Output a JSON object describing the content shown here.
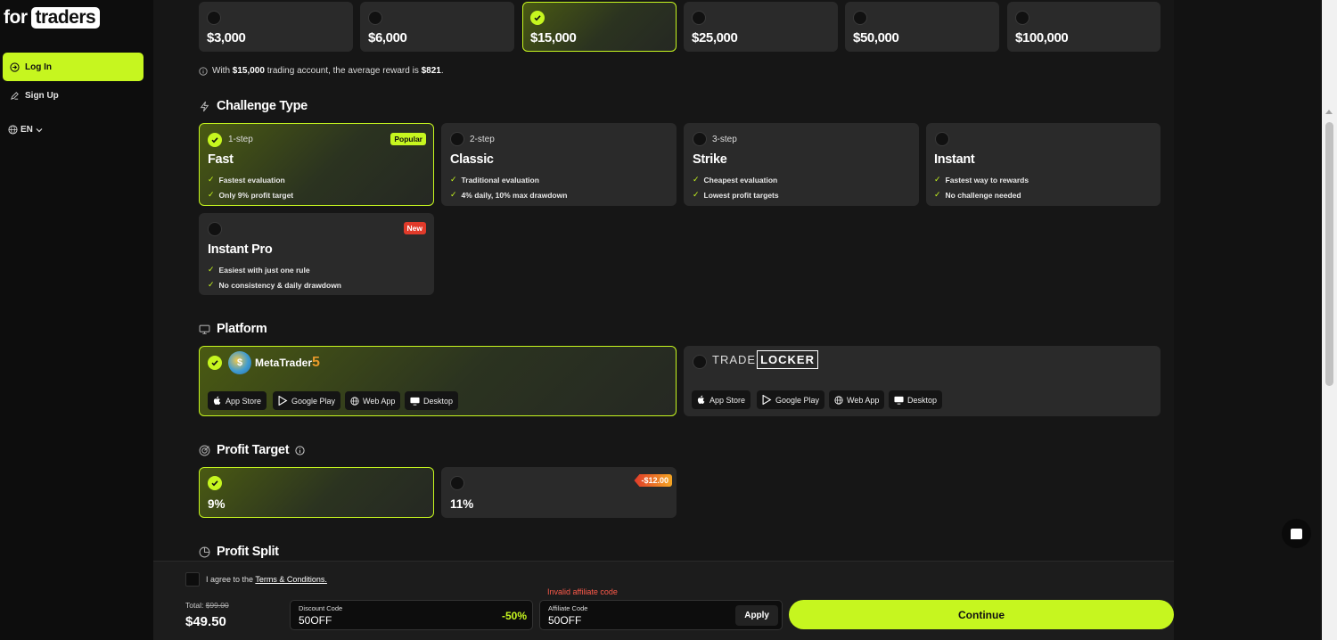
{
  "brand": {
    "for": "for",
    "traders": "traders"
  },
  "nav": {
    "login": "Log In",
    "signup": "Sign Up",
    "lang": "EN"
  },
  "accounts": [
    {
      "label": "$3,000",
      "selected": false
    },
    {
      "label": "$6,000",
      "selected": false
    },
    {
      "label": "$15,000",
      "selected": true
    },
    {
      "label": "$25,000",
      "selected": false
    },
    {
      "label": "$50,000",
      "selected": false
    },
    {
      "label": "$100,000",
      "selected": false
    }
  ],
  "info": {
    "pre": "With",
    "amount": "$15,000",
    "mid": "trading account, the average reward is",
    "reward": "$821",
    "post": "."
  },
  "challenge": {
    "title": "Challenge Type",
    "types": [
      {
        "step": "1-step",
        "name": "Fast",
        "badge": "Popular",
        "f1": "Fastest evaluation",
        "f2": "Only 9% profit target"
      },
      {
        "step": "2-step",
        "name": "Classic",
        "f1": "Traditional evaluation",
        "f2": "4% daily, 10% max drawdown"
      },
      {
        "step": "3-step",
        "name": "Strike",
        "f1": "Cheapest evaluation",
        "f2": "Lowest profit targets"
      },
      {
        "step": "",
        "name": "Instant",
        "f1": "Fastest way to rewards",
        "f2": "No challenge needed"
      },
      {
        "step": "",
        "name": "Instant Pro",
        "badge": "New",
        "f1": "Easiest with just one rule",
        "f2": "No consistency & daily drawdown"
      }
    ]
  },
  "platform": {
    "title": "Platform",
    "mt": {
      "name": "MetaTrader",
      "ver": "5"
    },
    "tl": {
      "trade": "TRADE",
      "locker": "LOCKER"
    },
    "chips": [
      "App Store",
      "Google Play",
      "Web App",
      "Desktop"
    ]
  },
  "profit_target": {
    "title": "Profit Target",
    "options": [
      {
        "label": "9%"
      },
      {
        "label": "11%",
        "badge": "-$12.00"
      }
    ]
  },
  "profit_split": {
    "title": "Profit Split"
  },
  "checkout": {
    "agree_pre": "I agree to the",
    "agree_link": "Terms & Conditions.",
    "total_label": "Total:",
    "total_old": "$99.00",
    "total": "$49.50",
    "discount_label": "Discount Code",
    "discount_value": "50OFF",
    "discount_pct": "-50%",
    "affiliate_error": "Invalid affiliate code",
    "affiliate_label": "Affiliate Code",
    "affiliate_value": "50OFF",
    "apply": "Apply",
    "continue": "Continue"
  },
  "colors": {
    "accent": "#c6f61f",
    "danger": "#e03a2a"
  }
}
